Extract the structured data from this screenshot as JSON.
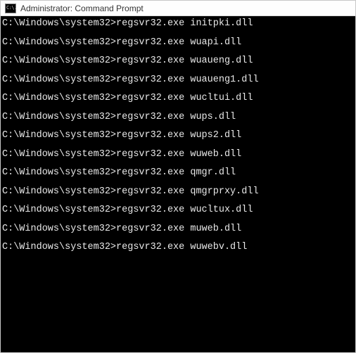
{
  "window": {
    "title": "Administrator: Command Prompt",
    "icon_glyph": "C:\\."
  },
  "terminal": {
    "prompt": "C:\\Windows\\system32>",
    "command": "regsvr32.exe",
    "lines": [
      "C:\\Windows\\system32>regsvr32.exe initpki.dll",
      "",
      "C:\\Windows\\system32>regsvr32.exe wuapi.dll",
      "",
      "C:\\Windows\\system32>regsvr32.exe wuaueng.dll",
      "",
      "C:\\Windows\\system32>regsvr32.exe wuaueng1.dll",
      "",
      "C:\\Windows\\system32>regsvr32.exe wucltui.dll",
      "",
      "C:\\Windows\\system32>regsvr32.exe wups.dll",
      "",
      "C:\\Windows\\system32>regsvr32.exe wups2.dll",
      "",
      "C:\\Windows\\system32>regsvr32.exe wuweb.dll",
      "",
      "C:\\Windows\\system32>regsvr32.exe qmgr.dll",
      "",
      "C:\\Windows\\system32>regsvr32.exe qmgrprxy.dll",
      "",
      "C:\\Windows\\system32>regsvr32.exe wucltux.dll",
      "",
      "C:\\Windows\\system32>regsvr32.exe muweb.dll",
      "",
      "C:\\Windows\\system32>regsvr32.exe wuwebv.dll",
      ""
    ]
  }
}
